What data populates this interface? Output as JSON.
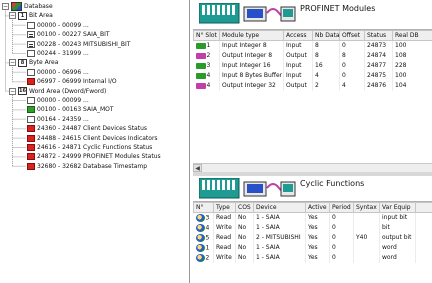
{
  "tree": {
    "root": "Database",
    "items": [
      {
        "label": "Bit Area",
        "kind": "group",
        "icon": "bit-area-icon"
      },
      {
        "label": "00000 - 00099 ...",
        "kind": "empty"
      },
      {
        "label": "00100 - 00227 SAIA_BIT",
        "kind": "bits"
      },
      {
        "label": "00228 - 00243 MITSUBISHI_BIT",
        "kind": "bits"
      },
      {
        "label": "00244 - 31999 ...",
        "kind": "empty"
      },
      {
        "label": "Byte Area",
        "kind": "group",
        "icon": "byte-area-icon"
      },
      {
        "label": "00000 - 06996 ...",
        "kind": "empty"
      },
      {
        "label": "06997 - 06999 Internal I/O",
        "kind": "red"
      },
      {
        "label": "Word Area (Dword/Fword)",
        "kind": "group",
        "icon": "word-area-icon"
      },
      {
        "label": "00000 - 00099 ...",
        "kind": "empty"
      },
      {
        "label": "00100 - 00163 SAIA_MOT",
        "kind": "green"
      },
      {
        "label": "00164 - 24359 ...",
        "kind": "empty"
      },
      {
        "label": "24360 - 24487 Client Devices Status",
        "kind": "red"
      },
      {
        "label": "24488 - 24615 Client Devices Indicators",
        "kind": "red"
      },
      {
        "label": "24616 - 24871 Cyclic Functions Status",
        "kind": "red"
      },
      {
        "label": "24872 - 24999 PROFINET Modules Status",
        "kind": "red"
      },
      {
        "label": "32680 - 32682 Database Timestamp",
        "kind": "red"
      }
    ],
    "group_glyphs": [
      "1",
      "8",
      "16"
    ]
  },
  "modules": {
    "title": "PROFINET Modules",
    "columns": [
      "N° Slot",
      "Module type",
      "Access",
      "Nb Data",
      "Offset",
      "Status",
      "Real DB"
    ],
    "rows": [
      [
        "1",
        "Input Integer 8",
        "Input",
        "8",
        "0",
        "24873",
        "100"
      ],
      [
        "2",
        "Output Integer 8",
        "Output",
        "8",
        "8",
        "24874",
        "108"
      ],
      [
        "3",
        "Input Integer 16",
        "Input",
        "16",
        "0",
        "24877",
        "228"
      ],
      [
        "4",
        "Input 8 Bytes Buffer",
        "Input",
        "4",
        "0",
        "24875",
        "100"
      ],
      [
        "4",
        "Output Integer 32",
        "Output",
        "2",
        "4",
        "24876",
        "104"
      ]
    ],
    "row_colors": [
      "#2a9a2a",
      "#c23ea8",
      "#2a9a2a",
      "#2a9a2a",
      "#c23ea8"
    ]
  },
  "cyclic": {
    "title": "Cyclic Functions",
    "columns": [
      "N°",
      "Type",
      "COS",
      "Device",
      "Active",
      "Period",
      "Syntax",
      "Var Equip",
      ""
    ],
    "rows": [
      [
        "3",
        "Read",
        "No",
        "1 - SAIA",
        "Yes",
        "0",
        "",
        "input bit",
        ""
      ],
      [
        "4",
        "Write",
        "No",
        "1 - SAIA",
        "Yes",
        "0",
        "",
        "bit",
        ""
      ],
      [
        "5",
        "Read",
        "No",
        "2 - MITSUBISHI",
        "Yes",
        "0",
        "Y40",
        "output bit",
        ""
      ],
      [
        "1",
        "Read",
        "No",
        "1 - SAIA",
        "Yes",
        "0",
        "",
        "word",
        ""
      ],
      [
        "2",
        "Write",
        "No",
        "1 - SAIA",
        "Yes",
        "0",
        "",
        "word",
        ""
      ]
    ]
  },
  "colors": {
    "selection_blue": "#2850c8",
    "status_red": "#d8231f",
    "status_green": "#2f9e2a",
    "read_module": "#2a9a2a",
    "write_module": "#c23ea8"
  }
}
